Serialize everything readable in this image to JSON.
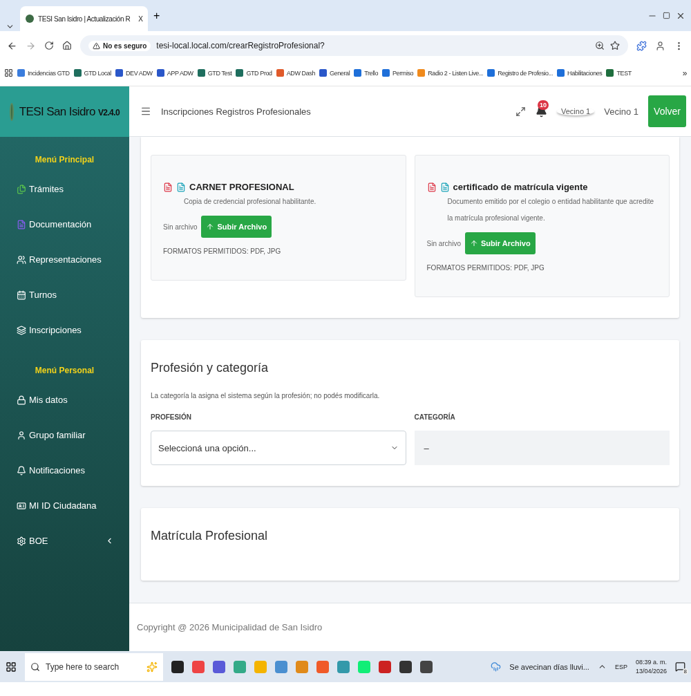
{
  "browser": {
    "tab": {
      "title": "TESI San Isidro | Actualización R",
      "close": "X"
    },
    "new_tab": "+",
    "security": "No es seguro",
    "url": "tesi-local.local.com/crearRegistroProfesional?",
    "bookmarks": [
      {
        "label": "Incidencias GTD",
        "color": "#3b7ddd"
      },
      {
        "label": "GTD Local",
        "color": "#1f6e5e"
      },
      {
        "label": "DEV ADW",
        "color": "#2a57c9"
      },
      {
        "label": "APP ADW",
        "color": "#2a57c9"
      },
      {
        "label": "GTD Test",
        "color": "#1f6e5e"
      },
      {
        "label": "GTD Prod",
        "color": "#1f6e5e"
      },
      {
        "label": "ADW Dash",
        "color": "#e05a2a"
      },
      {
        "label": "General",
        "color": "#2a57c9"
      },
      {
        "label": "Trello",
        "color": "#1e6fd9"
      },
      {
        "label": "Permiso",
        "color": "#1e6fd9"
      },
      {
        "label": "Radio 2 - Listen Live...",
        "color": "#f08a1c"
      },
      {
        "label": "Registro de Profesio...",
        "color": "#1e6fd9"
      },
      {
        "label": "Habilitaciones",
        "color": "#1e6fd9"
      },
      {
        "label": "TEST",
        "color": "#1f6e3e"
      }
    ],
    "more": "»"
  },
  "app": {
    "brand": "TESI San Isidro",
    "version": "V2.4.0",
    "page_title": "Inscripciones Registros Profesionales",
    "notifications": "10",
    "avatar_alt": "Vecino 1",
    "user": "Vecino 1",
    "back": "Volver"
  },
  "sidebar": [
    {
      "heading": "Menú Principal",
      "items": [
        {
          "label": "Trámites"
        },
        {
          "label": "Documentación"
        },
        {
          "label": "Representaciones"
        },
        {
          "label": "Turnos"
        },
        {
          "label": "Inscripciones"
        }
      ]
    },
    {
      "heading": "Menú Personal",
      "items": [
        {
          "label": "Mis datos"
        },
        {
          "label": "Grupo familiar"
        },
        {
          "label": "Notificaciones"
        },
        {
          "label": "MI ID Ciudadana"
        },
        {
          "label": "BOE",
          "expandable": true
        }
      ]
    }
  ],
  "documents": [
    {
      "title": "CARNET PROFESIONAL",
      "bold_title": true,
      "description": "Copia de credencial profesional habilitante.",
      "status": "Sin archivo",
      "button": "Subir Archivo",
      "formats": "FORMATOS PERMITIDOS: PDF, JPG"
    },
    {
      "title": "certificado de matrícula vigente",
      "bold_title": true,
      "description": "Documento emitido por el colegio o entidad habilitante que acredite la matrícula profesional vigente.",
      "status": "Sin archivo",
      "button": "Subir Archivo",
      "formats": "FORMATOS PERMITIDOS: PDF, JPG"
    }
  ],
  "profession_section": {
    "title": "Profesión y categoría",
    "help": "La categoría la asigna el sistema según la profesión; no podés modificarla.",
    "profession_label": "PROFESIÓN",
    "profession_placeholder": "Seleccioná una opción...",
    "category_label": "CATEGORÍA",
    "category_value": "–"
  },
  "next_section": {
    "title": "Matrícula Profesional"
  },
  "footer": "Copyright @ 2026 Municipalidad de San Isidro",
  "taskbar": {
    "search_placeholder": "Type here to search",
    "weather": "Se avecinan días lluvi...",
    "language": "ESP",
    "time": "08:39 a. m.",
    "date": "13/04/2026",
    "notification_count": "8"
  }
}
